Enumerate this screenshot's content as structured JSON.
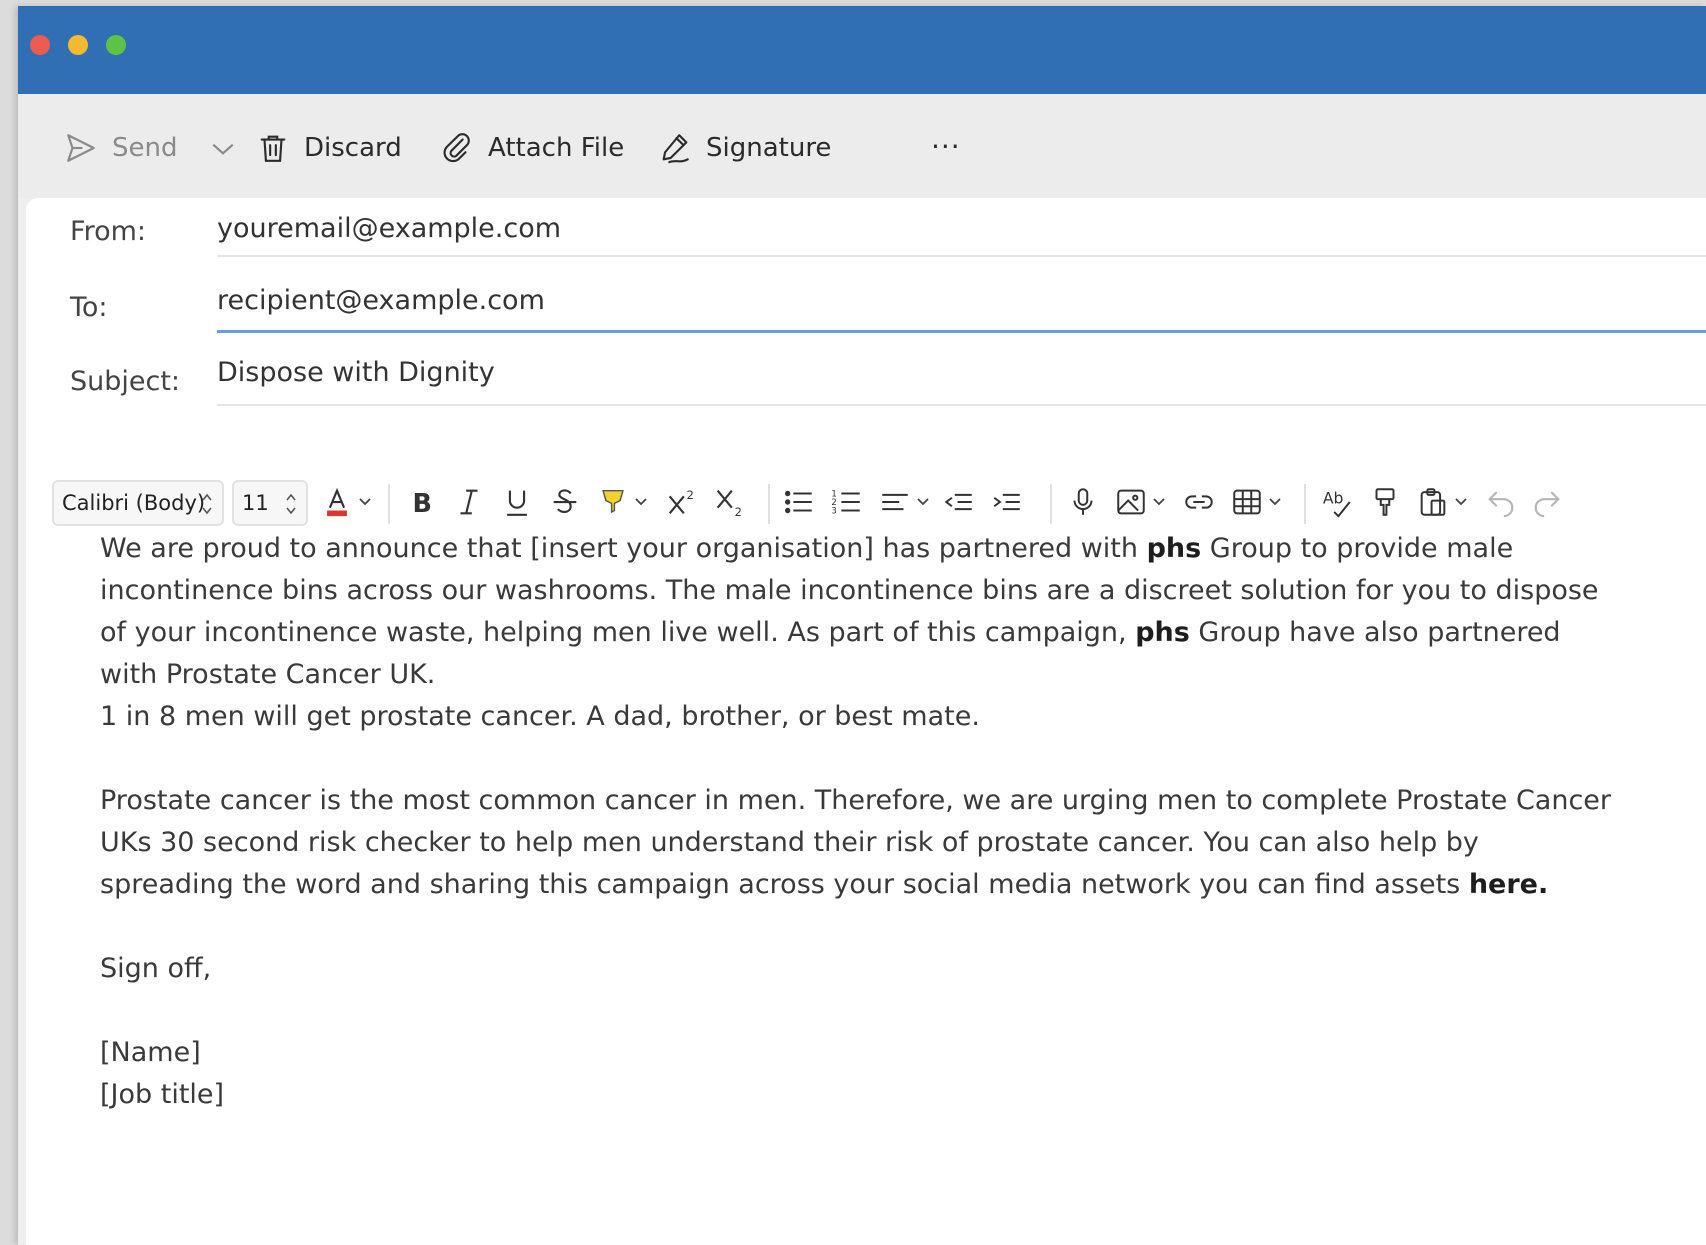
{
  "toolbar": {
    "send_label": "Send",
    "discard_label": "Discard",
    "attach_label": "Attach File",
    "signature_label": "Signature",
    "more_label": "···"
  },
  "fields": {
    "from_label": "From:",
    "from_value": "youremail@example.com",
    "to_label": "To:",
    "to_value": "recipient@example.com",
    "subject_label": "Subject:",
    "subject_value": "Dispose with Dignity"
  },
  "format": {
    "font_name": "Calibri (Body)",
    "font_size": "11",
    "text_color": "#d63a2f",
    "highlight_color": "#f3d22e"
  },
  "body": {
    "p1a": "We are proud to announce that [insert your organisation] has partnered with ",
    "p1b": "phs",
    "p1c": " Group to provide male incontinence bins across our washrooms. The male incontinence bins are a discreet solution for you to dispose of your incontinence waste, helping men live well. As part of this campaign, ",
    "p1d": "phs",
    "p1e": " Group have also partnered with Prostate Cancer UK.",
    "p2": "1 in 8 men will get prostate cancer. A dad, brother, or best mate.",
    "p3a": "Prostate cancer is the most common cancer in men. Therefore, we are urging men to complete Prostate Cancer UKs 30 second risk checker to help men understand their risk of prostate cancer. You can also help by spreading the word and sharing this campaign across your social media network you can find assets ",
    "p3b": "here.",
    "p4": "Sign off,",
    "p5": "[Name]",
    "p6": "[Job title]"
  },
  "colors": {
    "titlebar": "#316fb5",
    "accent_line": "#6b9ee0"
  }
}
